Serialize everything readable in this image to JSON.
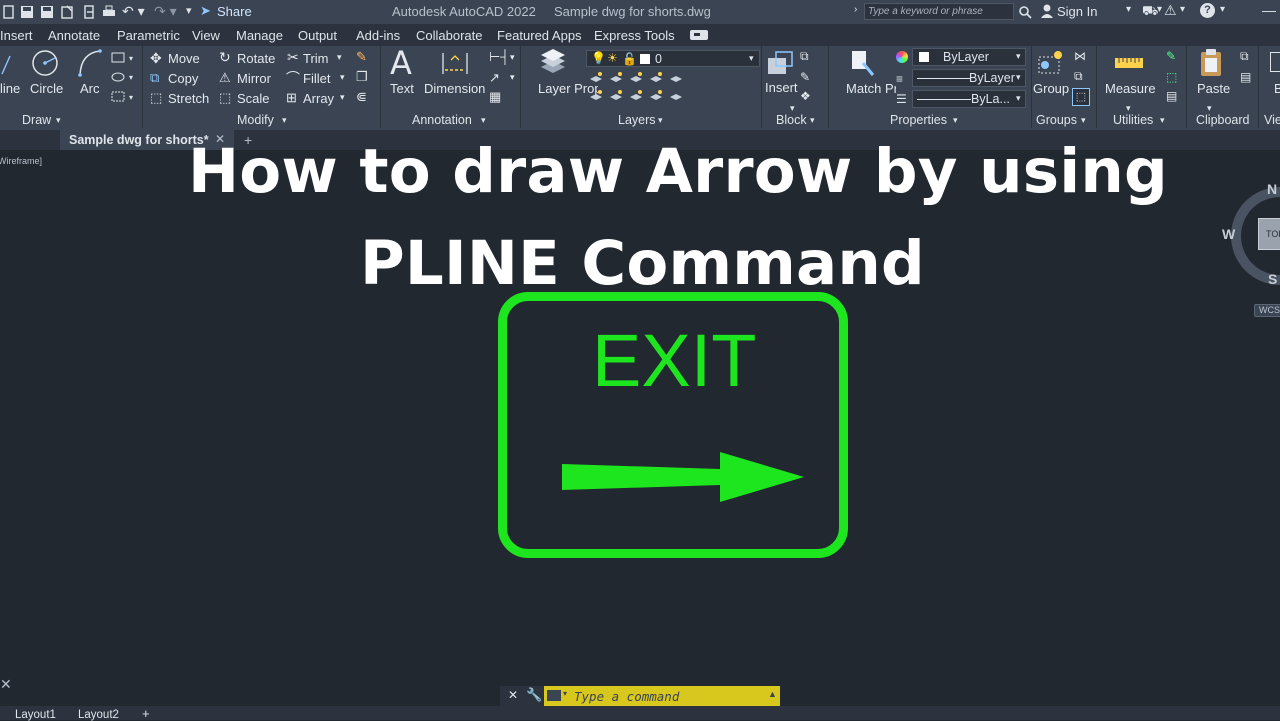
{
  "titlebar": {
    "share_label": "Share",
    "app_title": "Autodesk AutoCAD 2022",
    "file_title": "Sample dwg for shorts.dwg",
    "search_placeholder": "Type a keyword or phrase",
    "signin_label": "Sign In"
  },
  "menu": {
    "items": [
      "Insert",
      "Annotate",
      "Parametric",
      "View",
      "Manage",
      "Output",
      "Add-ins",
      "Collaborate",
      "Featured Apps",
      "Express Tools"
    ]
  },
  "ribbon": {
    "draw": {
      "label": "Draw",
      "line": "line",
      "circle": "Circle",
      "arc": "Arc"
    },
    "modify": {
      "label": "Modify",
      "move": "Move",
      "rotate": "Rotate",
      "trim": "Trim",
      "copy": "Copy",
      "mirror": "Mirror",
      "fillet": "Fillet",
      "stretch": "Stretch",
      "scale": "Scale",
      "array": "Array"
    },
    "annotation": {
      "label": "Annotation",
      "text": "Text",
      "dimension": "Dimension"
    },
    "layers": {
      "label": "Layers",
      "layer_properties": "Layer Properties",
      "current_layer": "0"
    },
    "block": {
      "label": "Block",
      "insert": "Insert"
    },
    "properties": {
      "label": "Properties",
      "match": "Match Properties",
      "color": "ByLayer",
      "linetype": "ByLayer",
      "lineweight": "ByLa..."
    },
    "groups": {
      "label": "Groups",
      "group": "Group"
    },
    "utilities": {
      "label": "Utilities",
      "measure": "Measure"
    },
    "clipboard": {
      "label": "Clipboard",
      "paste": "Paste"
    },
    "view": {
      "label": "Vie"
    }
  },
  "doctab": {
    "name": "Sample dwg for shorts*"
  },
  "viewport": {
    "label": "Wireframe]"
  },
  "headline": {
    "line1": "How to draw Arrow by using",
    "line2": "PLINE  Command"
  },
  "sign": {
    "text": "EXIT",
    "color": "#1ee61e"
  },
  "viewcube": {
    "north": "N",
    "west": "W",
    "south": "S",
    "face": "TOP",
    "wcs": "WCS"
  },
  "command": {
    "placeholder": "Type a command"
  },
  "layouts": {
    "tab1": "Layout1",
    "tab2": "Layout2"
  }
}
